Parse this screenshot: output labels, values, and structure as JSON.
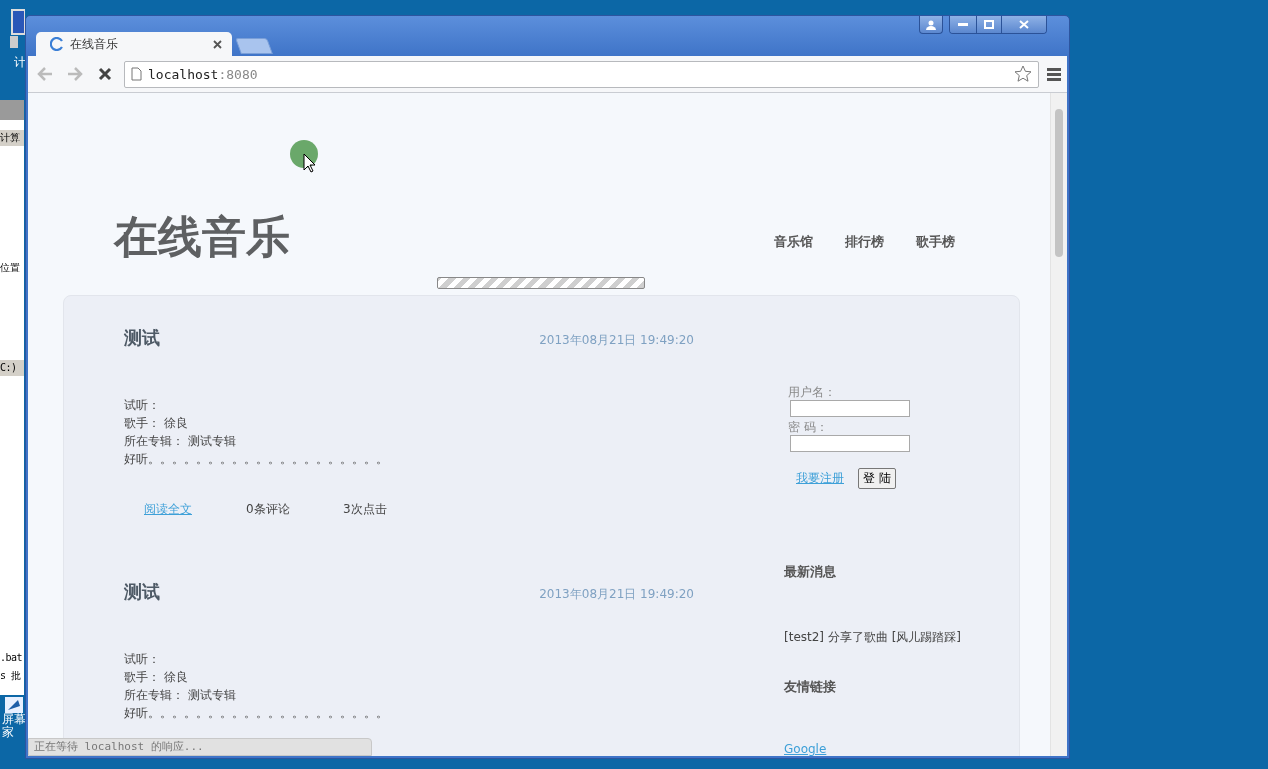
{
  "desktop": {
    "icons": [
      {
        "label_lines": [
          "计"
        ]
      },
      {
        "label_lines": [
          "屏幕",
          "家"
        ]
      }
    ]
  },
  "background_window": {
    "fragments": [
      "计算",
      "位置",
      "C:)",
      ".bat",
      "s 批"
    ]
  },
  "browser": {
    "tab": {
      "title": "在线音乐",
      "loading": true
    },
    "nav_buttons": [
      {
        "kind": "back",
        "disabled": true
      },
      {
        "kind": "forward",
        "disabled": true
      }
    ],
    "address": {
      "host": "localhost",
      "port": ":8080"
    },
    "status_bubble": "正在等待 localhost 的响应..."
  },
  "page": {
    "site_title": "在线音乐",
    "nav": [
      "音乐馆",
      "排行榜",
      "歌手榜"
    ],
    "posts": [
      {
        "title": "测试",
        "date": "2013年08月21日 19:49:20",
        "lines": [
          "试听：",
          "歌手： 徐良",
          "所在专辑： 测试专辑",
          "好听。。。。。。。。。。。。。。。。。。。。"
        ],
        "footer": {
          "read_more": "阅读全文",
          "comments": "0条评论",
          "clicks": "3次点击"
        }
      },
      {
        "title": "测试",
        "date": "2013年08月21日 19:49:20",
        "lines": [
          "试听：",
          "歌手： 徐良",
          "所在专辑： 测试专辑",
          "好听。。。。。。。。。。。。。。。。。。。。"
        ]
      }
    ],
    "login": {
      "username_label": "用户名：",
      "password_label": "密 码：",
      "register_link": "我要注册",
      "login_button": "登 陆"
    },
    "news": {
      "heading": "最新消息",
      "items": [
        "[test2] 分享了歌曲 [风儿踢踏踩]"
      ]
    },
    "links": {
      "heading": "友情链接",
      "items": [
        "Google"
      ]
    }
  }
}
